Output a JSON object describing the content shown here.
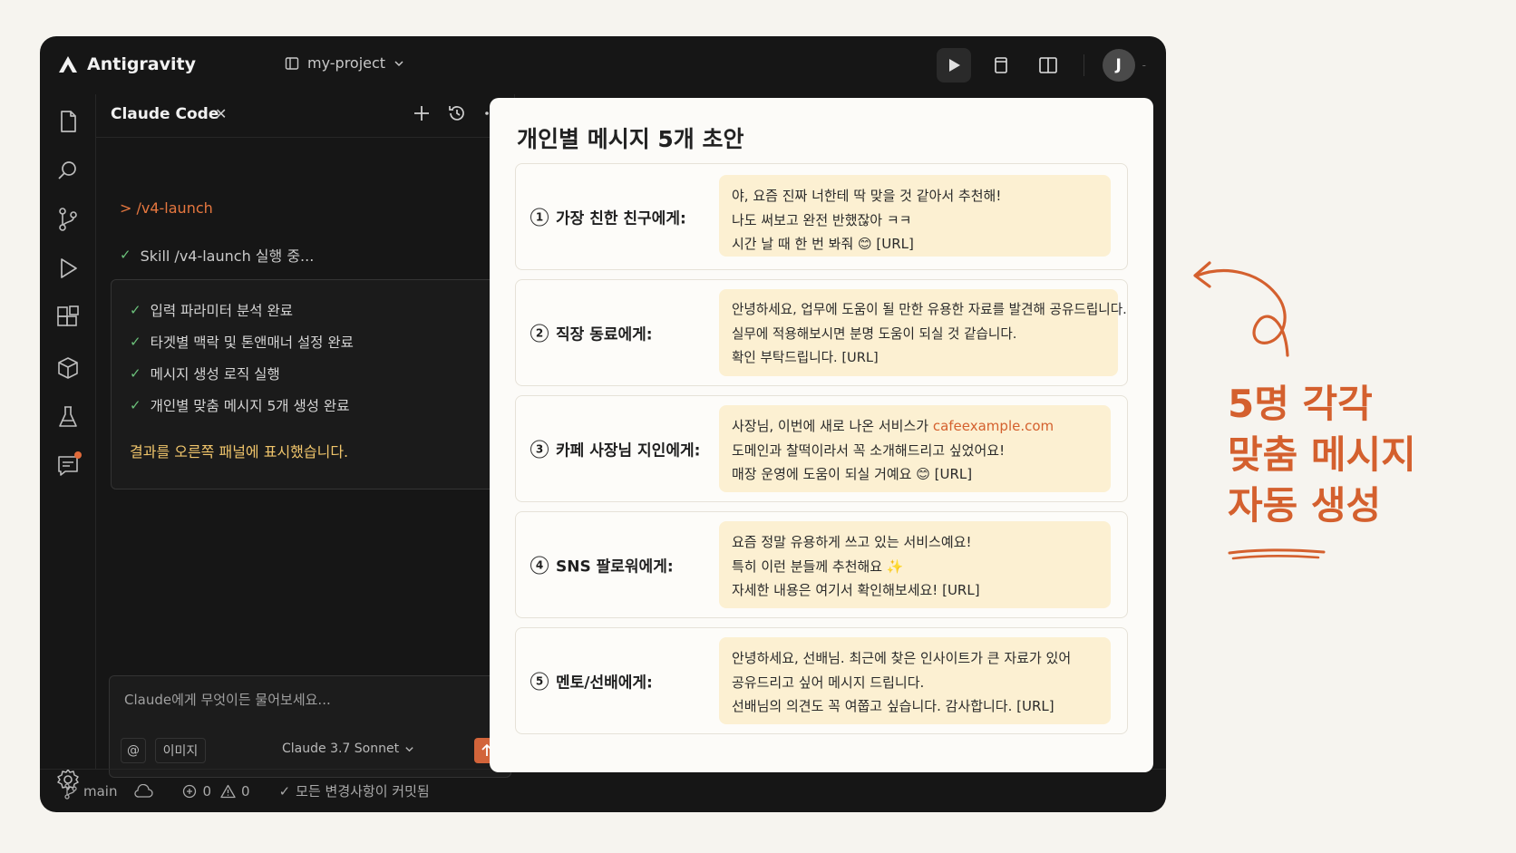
{
  "app": {
    "name": "Antigravity",
    "project": "my-project",
    "avatar_initial": "J"
  },
  "panel": {
    "title": "Claude Code",
    "command": "> /v4-launch",
    "skill_status": "Skill  /v4-launch 실행 중...",
    "steps": [
      "입력 파라미터 분석 완료",
      "타겟별 맥락 및 톤앤매너 설정 완료",
      "메시지 생성 로직 실행",
      "개인별 맞춤 메시지 5개 생성 완료"
    ],
    "result": "결과를 오른쪽 패널에 표시했습니다.",
    "composer": {
      "placeholder": "Claude에게 무엇이든 물어보세요...",
      "at_label": "@",
      "image_label": "이미지",
      "model": "Claude 3.7 Sonnet"
    }
  },
  "status": {
    "branch": "main",
    "errors": "0",
    "warnings": "0",
    "commit_status": "모든 변경사항이 커밋됨"
  },
  "document": {
    "title": "개인별 메시지 5개 초안",
    "messages": [
      {
        "number": "1",
        "label": "가장 친한 친구에게:",
        "lines": [
          "야, 요즘 진짜 너한테 딱 맞을 것 같아서 추천해!",
          "나도 써보고 완전 반했잖아 ㅋㅋ",
          "시간 날 때 한 번 봐줘 😊 [URL]"
        ]
      },
      {
        "number": "2",
        "label": "직장 동료에게:",
        "lines": [
          "안녕하세요, 업무에 도움이 될 만한 유용한 자료를 발견해 공유드립니다.",
          "실무에 적용해보시면 분명 도움이 되실 것 같습니다.",
          "확인 부탁드립니다. [URL]"
        ]
      },
      {
        "number": "3",
        "label": "카페 사장님 지인에게:",
        "lines": [
          "사장님, 이번에 새로 나온 서비스가",
          "도메인과 찰떡이라서 꼭 소개해드리고 싶었어요!",
          "매장 운영에 도움이 되실 거예요 😊 [URL]"
        ],
        "link": "cafeexample.com"
      },
      {
        "number": "4",
        "label": "SNS 팔로워에게:",
        "lines": [
          "요즘 정말 유용하게 쓰고 있는 서비스예요!",
          "특히 이런 분들께 추천해요 ✨",
          "자세한 내용은 여기서 확인해보세요! [URL]"
        ]
      },
      {
        "number": "5",
        "label": "멘토/선배에게:",
        "lines": [
          "안녕하세요, 선배님. 최근에 찾은 인사이트가 큰 자료가 있어",
          "공유드리고 싶어 메시지 드립니다.",
          "선배님의 의견도 꼭 여쭙고 싶습니다. 감사합니다. [URL]"
        ]
      }
    ]
  },
  "annotation": {
    "lines": [
      "5명 각각",
      "맞춤 메시지",
      "자동 생성"
    ]
  },
  "colors": {
    "accent": "#d4602e",
    "bubble": "#fcf0d2",
    "window": "#161616",
    "success": "#6bc07a",
    "result": "#f0c56b"
  }
}
